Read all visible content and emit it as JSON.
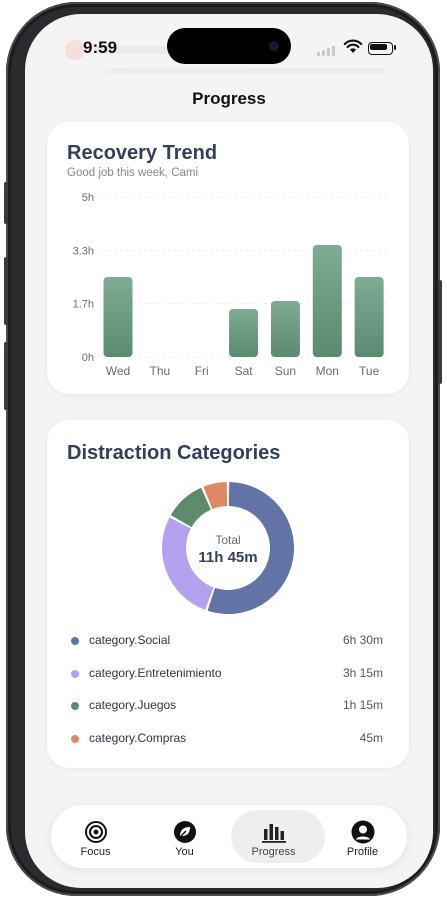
{
  "status": {
    "time": "9:59"
  },
  "header": {
    "title": "Progress"
  },
  "recovery": {
    "title": "Recovery Trend",
    "subtitle": "Good job this week, Cami"
  },
  "chart_data": [
    {
      "type": "bar",
      "categories": [
        "Wed",
        "Thu",
        "Fri",
        "Sat",
        "Sun",
        "Mon",
        "Tue"
      ],
      "values": [
        2.5,
        0,
        0,
        1.5,
        1.75,
        3.5,
        2.5
      ],
      "yticks": [
        "0h",
        "1.7h",
        "3.3h",
        "5h"
      ],
      "ylim": [
        0,
        5
      ],
      "unit": "h",
      "grid": true,
      "color": "#6a9a80"
    },
    {
      "type": "pie",
      "title": "Distraction Categories",
      "slices": [
        {
          "name": "category.Social",
          "value": 390,
          "label": "6h 30m",
          "color": "#6274a6"
        },
        {
          "name": "category.Entretenimiento",
          "value": 195,
          "label": "3h 15m",
          "color": "#b3a0ee"
        },
        {
          "name": "category.Juegos",
          "value": 75,
          "label": "1h 15m",
          "color": "#5e8a6e"
        },
        {
          "name": "category.Compras",
          "value": 45,
          "label": "45m",
          "color": "#df8a62"
        }
      ],
      "center_label": "Total",
      "center_value": "11h 45m"
    }
  ],
  "categories_card": {
    "title": "Distraction Categories",
    "total_label": "Total",
    "total_value": "11h 45m",
    "items": [
      {
        "name": "category.Social",
        "value": "6h 30m",
        "color": "#6274a6"
      },
      {
        "name": "category.Entretenimiento",
        "value": "3h 15m",
        "color": "#b3a0ee"
      },
      {
        "name": "category.Juegos",
        "value": "1h 15m",
        "color": "#5e8a6e"
      },
      {
        "name": "category.Compras",
        "value": "45m",
        "color": "#df8a62"
      }
    ]
  },
  "tabs": [
    {
      "label": "Focus",
      "icon": "target-icon",
      "active": false
    },
    {
      "label": "You",
      "icon": "leaf-icon",
      "active": false
    },
    {
      "label": "Progress",
      "icon": "bar-chart-icon",
      "active": true
    },
    {
      "label": "Profile",
      "icon": "user-icon",
      "active": false
    }
  ]
}
